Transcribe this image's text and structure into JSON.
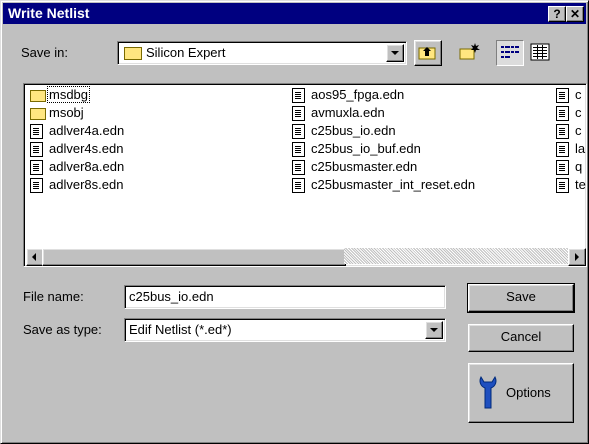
{
  "window": {
    "title": "Write Netlist",
    "help_label": "?",
    "close_label": "✕"
  },
  "save_in": {
    "label": "Save in:",
    "value": "Silicon Expert"
  },
  "toolbar": {
    "up_folder_icon": "up-folder-icon",
    "new_folder_icon": "new-folder-icon",
    "list_view_icon": "list-view-icon",
    "details_view_icon": "details-view-icon"
  },
  "files": {
    "column1": [
      {
        "name": "msdbg",
        "type": "folder"
      },
      {
        "name": "msobj",
        "type": "folder"
      },
      {
        "name": "adlver4a.edn",
        "type": "file"
      },
      {
        "name": "adlver4s.edn",
        "type": "file"
      },
      {
        "name": "adlver8a.edn",
        "type": "file"
      },
      {
        "name": "adlver8s.edn",
        "type": "file"
      }
    ],
    "column2": [
      {
        "name": "aos95_fpga.edn",
        "type": "file"
      },
      {
        "name": "avmuxla.edn",
        "type": "file"
      },
      {
        "name": "c25bus_io.edn",
        "type": "file"
      },
      {
        "name": "c25bus_io_buf.edn",
        "type": "file"
      },
      {
        "name": "c25busmaster.edn",
        "type": "file"
      },
      {
        "name": "c25busmaster_int_reset.edn",
        "type": "file"
      }
    ],
    "column3": [
      {
        "name": "c",
        "type": "file"
      },
      {
        "name": "c",
        "type": "file"
      },
      {
        "name": "c",
        "type": "file"
      },
      {
        "name": "la",
        "type": "file"
      },
      {
        "name": "q",
        "type": "file"
      },
      {
        "name": "te",
        "type": "file"
      }
    ]
  },
  "file_name": {
    "label": "File name:",
    "value": "c25bus_io.edn"
  },
  "save_as_type": {
    "label": "Save as type:",
    "value": "Edif Netlist (*.ed*)"
  },
  "buttons": {
    "save": "Save",
    "cancel": "Cancel",
    "options": "Options"
  }
}
